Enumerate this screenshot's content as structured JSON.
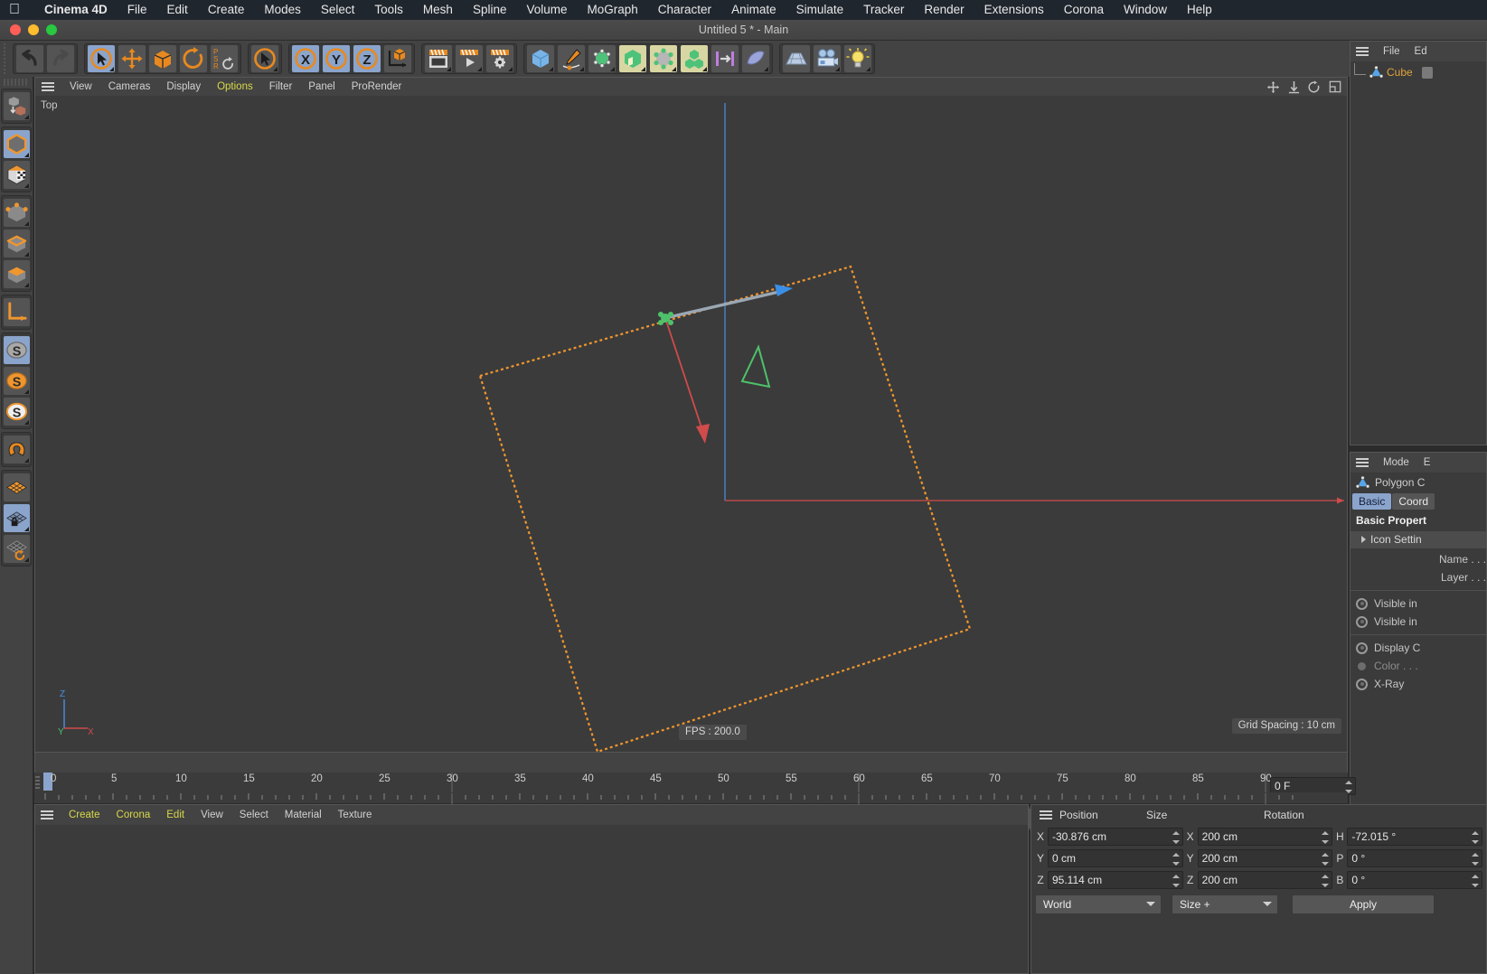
{
  "menubar": {
    "apple_icon": "apple-logo",
    "app_name": "Cinema 4D",
    "items": [
      "File",
      "Edit",
      "Create",
      "Modes",
      "Select",
      "Tools",
      "Mesh",
      "Spline",
      "Volume",
      "MoGraph",
      "Character",
      "Animate",
      "Simulate",
      "Tracker",
      "Render",
      "Extensions",
      "Corona",
      "Window",
      "Help"
    ]
  },
  "titlebar": {
    "title": "Untitled 5 * - Main"
  },
  "viewport_menu": {
    "items": [
      "View",
      "Cameras",
      "Display",
      "Options",
      "Filter",
      "Panel",
      "ProRender"
    ],
    "highlighted": "Options"
  },
  "viewport": {
    "view_label": "Top",
    "fps_label": "FPS : 200.0",
    "grid_label": "Grid Spacing : 10 cm",
    "axis_z": "Z",
    "axis_y": "Y",
    "axis_x": "X",
    "selection_color": "#f0962e",
    "x_axis_color": "#d84b4b",
    "z_axis_color": "#4a8fe0",
    "y_axis_color": "#4ec26b"
  },
  "object_manager": {
    "menu": [
      "File",
      "Ed"
    ],
    "objects": [
      {
        "name": "Cube"
      }
    ]
  },
  "attribute_manager": {
    "menu": [
      "Mode",
      "E"
    ],
    "object_title": "Polygon C",
    "tabs": [
      "Basic",
      "Coord"
    ],
    "active_tab": "Basic",
    "section_title": "Basic Propert",
    "folder": "Icon Settin",
    "props": [
      "Name . . .",
      "Layer . . ."
    ],
    "toggles": [
      "Visible in",
      "Visible in",
      "Display C",
      "Color . . .",
      "X-Ray"
    ]
  },
  "timeline": {
    "ticks": [
      "0",
      "5",
      "10",
      "15",
      "20",
      "25",
      "30",
      "35",
      "40",
      "45",
      "50",
      "55",
      "60",
      "65",
      "70",
      "75",
      "80",
      "85",
      "90"
    ],
    "current_frame": "0 F",
    "playhead_field": "0 F",
    "range_start": "0 F",
    "range_end": "90 F",
    "preview_end": "90 F",
    "end_frame": "0 F"
  },
  "material_manager": {
    "menu": [
      "Create",
      "Corona",
      "Edit",
      "View",
      "Select",
      "Material",
      "Texture"
    ],
    "highlighted": [
      "Create",
      "Corona",
      "Edit"
    ]
  },
  "coordinates": {
    "title_position": "Position",
    "title_size": "Size",
    "title_rotation": "Rotation",
    "rows": [
      {
        "plab": "X",
        "pval": "-30.876 cm",
        "slab": "X",
        "sval": "200 cm",
        "rlab": "H",
        "rval": "-72.015 °"
      },
      {
        "plab": "Y",
        "pval": "0 cm",
        "slab": "Y",
        "sval": "200 cm",
        "rlab": "P",
        "rval": "0 °"
      },
      {
        "plab": "Z",
        "pval": "95.114 cm",
        "slab": "Z",
        "sval": "200 cm",
        "rlab": "B",
        "rval": "0 °"
      }
    ],
    "coord_system": "World",
    "size_mode": "Size +",
    "apply_label": "Apply"
  },
  "theme": {
    "bg": "#3b3b3b",
    "panel": "#434343",
    "accent_orange": "#f0962e",
    "accent_blue": "#8aa4cc",
    "text": "#d2d2d2"
  }
}
